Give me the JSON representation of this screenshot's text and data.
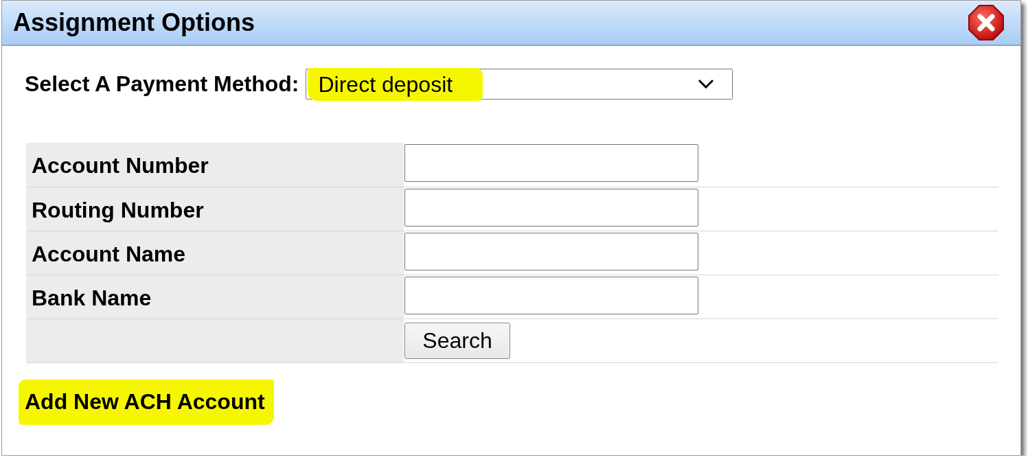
{
  "window": {
    "title": "Assignment Options"
  },
  "payment_method": {
    "label": "Select A Payment Method:",
    "value": "Direct deposit",
    "highlighted": true
  },
  "fields": [
    {
      "label": "Account Number"
    },
    {
      "label": "Routing Number"
    },
    {
      "label": "Account Name"
    },
    {
      "label": "Bank Name"
    }
  ],
  "search_button": {
    "label": "Search"
  },
  "add_account_link": {
    "text": "Add New ACH Account",
    "highlighted": true
  }
}
